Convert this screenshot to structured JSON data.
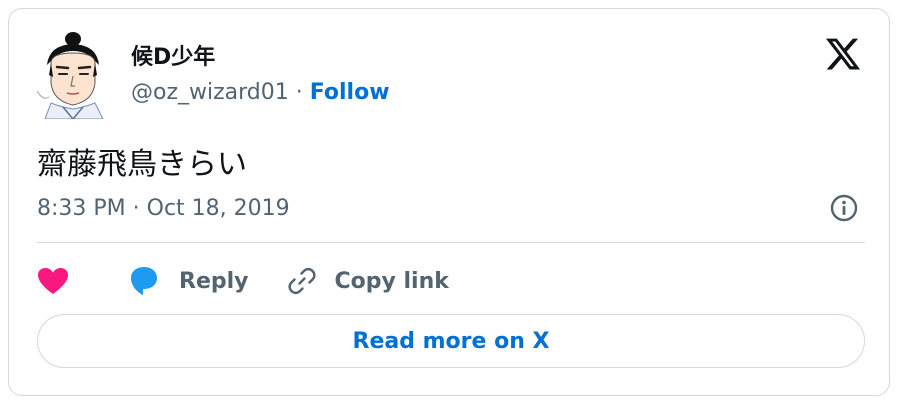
{
  "author": {
    "display_name": "候D少年",
    "handle": "@oz_wizard01",
    "separator": " · ",
    "follow_label": "Follow"
  },
  "tweet": {
    "text": "齋藤飛鳥きらい",
    "timestamp": "8:33 PM · Oct 18, 2019"
  },
  "actions": {
    "reply_label": "Reply",
    "copy_link_label": "Copy link"
  },
  "footer": {
    "read_more_label": "Read more on X"
  },
  "icons": {
    "brand": "x-logo-icon",
    "info": "info-icon",
    "like": "heart-icon",
    "reply": "speech-bubble-icon",
    "copy": "link-icon"
  },
  "colors": {
    "link_blue": "#006fd6",
    "heart": "#f91880",
    "reply_bubble": "#1d9bf0",
    "text_primary": "#0f1419",
    "text_secondary": "#536471",
    "border": "#cfd9de"
  }
}
